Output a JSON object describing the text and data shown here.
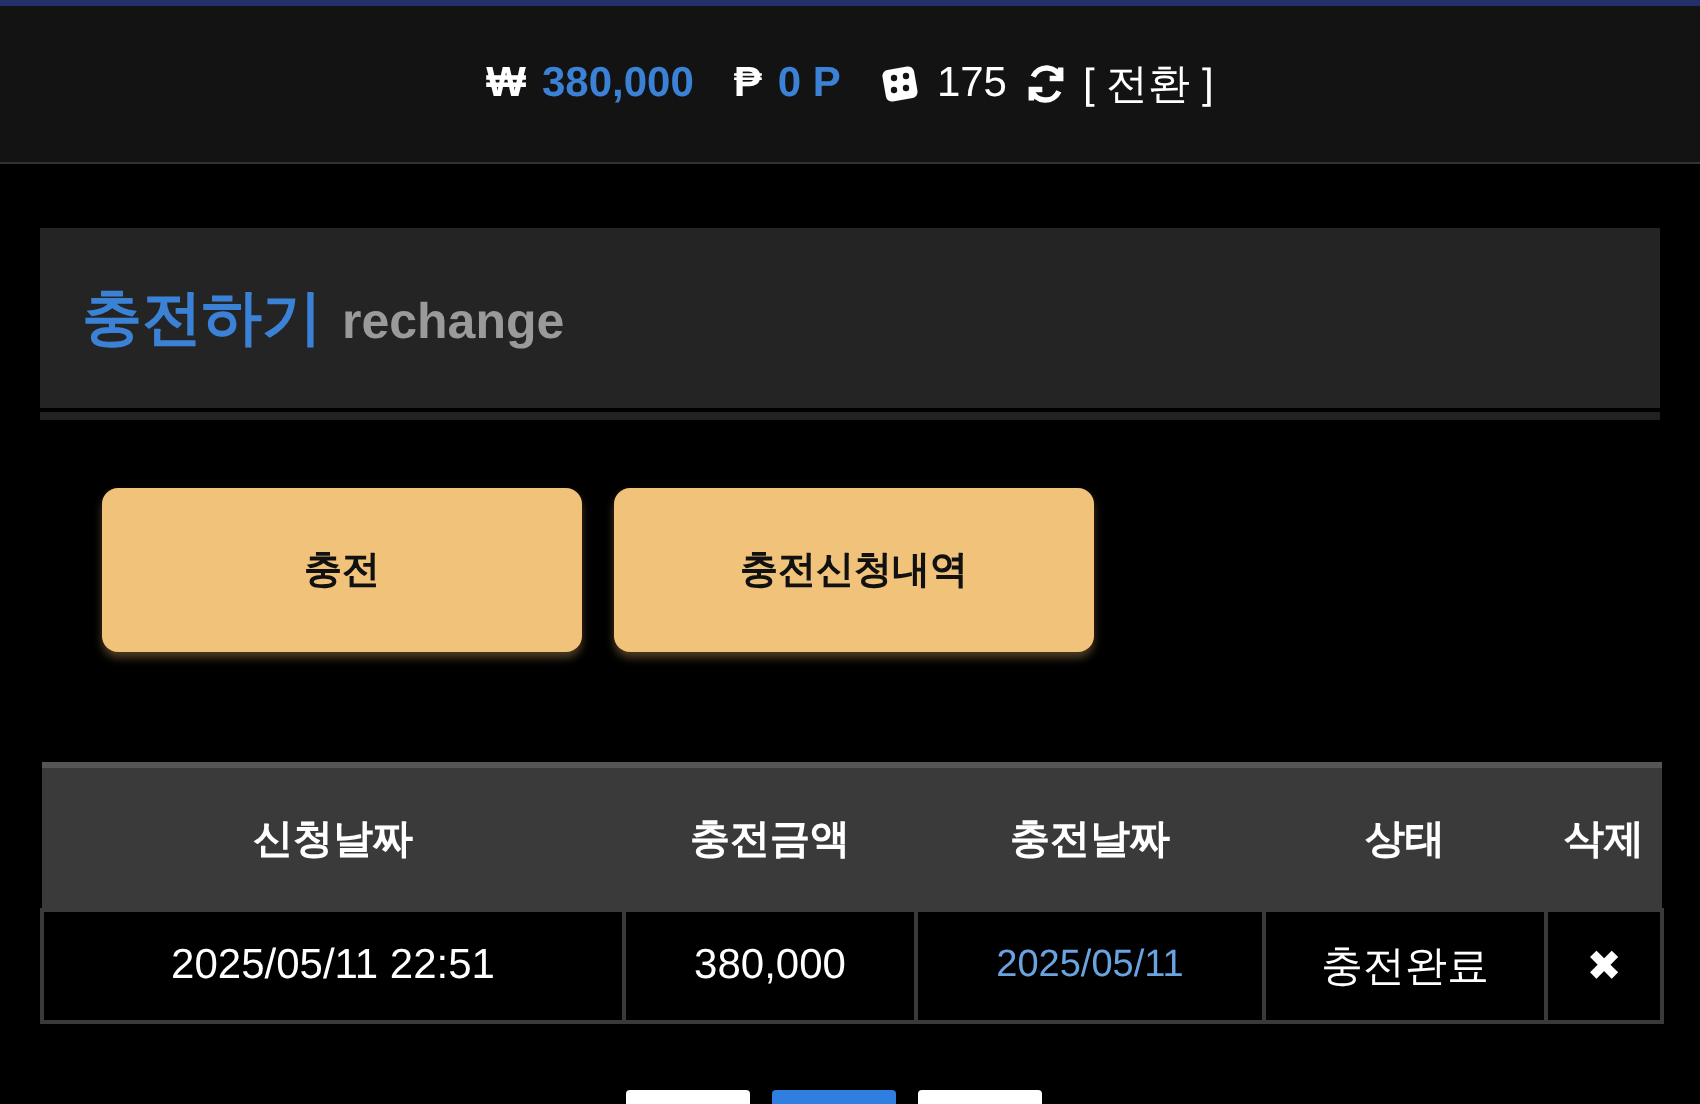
{
  "topbar": {
    "money_symbol": "₩",
    "money": "380,000",
    "point_symbol": "₱",
    "points": "0 P",
    "chips": "175",
    "switch_label": "[ 전환 ]"
  },
  "panel": {
    "title": "충전하기",
    "subtitle": "rechange"
  },
  "buttons": [
    "충전",
    "충전신청내역"
  ],
  "table": {
    "columns": [
      "신청날짜",
      "충전금액",
      "충전날짜",
      "상태",
      "삭제"
    ],
    "rows": [
      {
        "requested": "2025/05/11 22:51",
        "amount": "380,000",
        "charged": "2025/05/11",
        "status": "충전완료",
        "delete": "✖"
      }
    ]
  },
  "pages": [
    {
      "selected": false
    },
    {
      "selected": true
    },
    {
      "selected": false
    }
  ]
}
